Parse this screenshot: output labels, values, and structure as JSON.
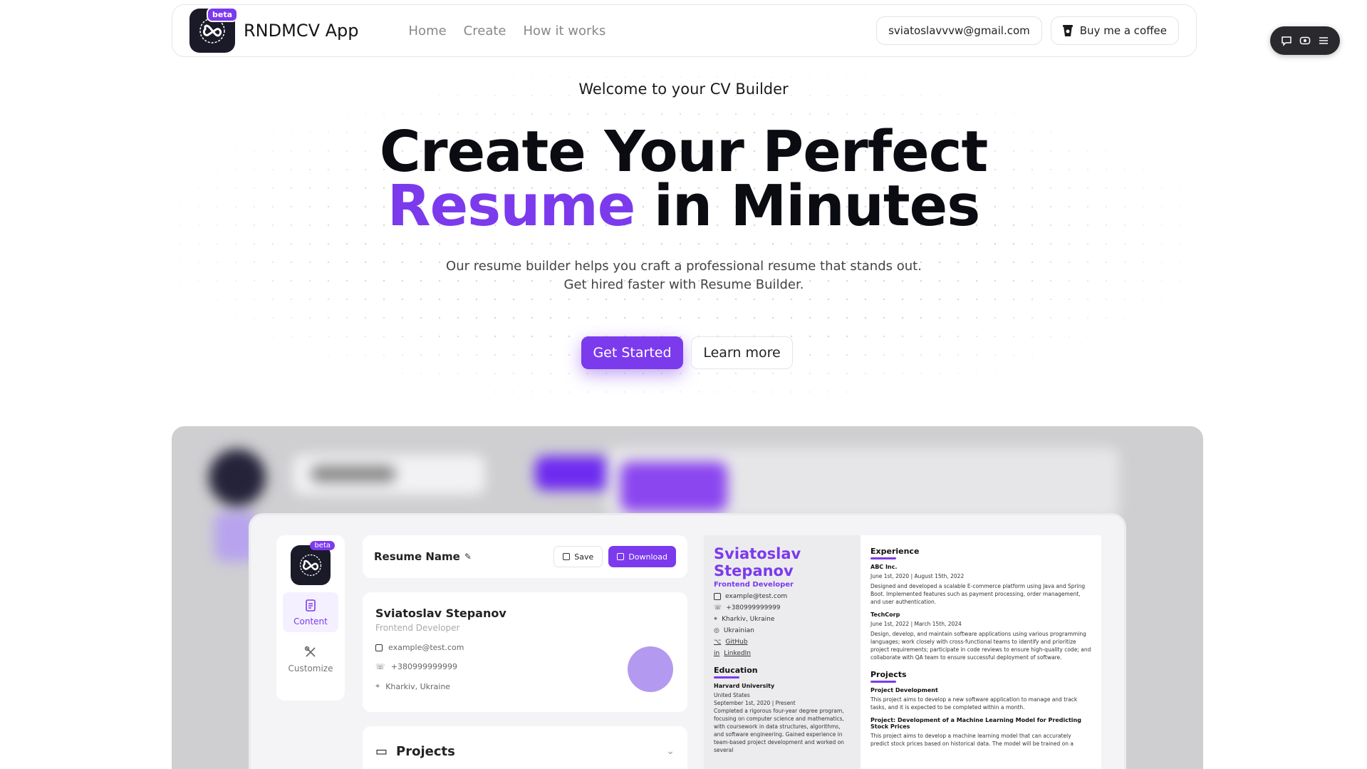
{
  "header": {
    "brand": "RNDMCV App",
    "beta": "beta",
    "nav": [
      "Home",
      "Create",
      "How it works"
    ],
    "email": "sviatoslavvvw@gmail.com",
    "coffee": "Buy me a coffee"
  },
  "hero": {
    "welcome": "Welcome to your CV Builder",
    "title_line1": "Create Your Perfect",
    "title_accent": "Resume",
    "title_rest": " in Minutes",
    "subtitle": "Our resume builder helps you craft a professional resume that stands out. Get hired faster with Resume Builder.",
    "primary_button": "Get Started",
    "secondary_button": "Learn more"
  },
  "preview": {
    "beta": "beta",
    "sidebar": [
      "Content",
      "Customize"
    ],
    "resume_name": "Resume Name",
    "save": "Save",
    "download": "Download",
    "person": {
      "name": "Sviatoslav Stepanov",
      "role": "Frontend Developer",
      "email": "example@test.com",
      "phone": "+380999999999",
      "location": "Kharkiv, Ukraine"
    },
    "projects_label": "Projects",
    "doc": {
      "name": "Sviatoslav Stepanov",
      "role": "Frontend Developer",
      "email": "example@test.com",
      "phone": "+380999999999",
      "location": "Kharkiv, Ukraine",
      "language": "Ukrainian",
      "github": "GitHub",
      "linkedin": "LinkedIn",
      "education_h": "Education",
      "edu_school": "Harvard University",
      "edu_country": "United States",
      "edu_dates": "September 1st, 2020 | Present",
      "edu_text": "Completed a rigorous four-year degree program, focusing on computer science and mathematics, with coursework in data structures, algorithms, and software engineering. Gained experience in team-based project development and worked on several",
      "experience_h": "Experience",
      "exp1_company": "ABC Inc.",
      "exp1_dates": "June 1st, 2020 | August 15th, 2022",
      "exp1_text": "Designed and developed a scalable E-commerce platform using Java and Spring Boot. Implemented features such as payment processing, order management, and user authentication.",
      "exp2_company": "TechCorp",
      "exp2_dates": "June 1st, 2022 | March 15th, 2024",
      "exp2_text": "Design, develop, and maintain software applications using various programming languages; work closely with cross-functional teams to identify and prioritize project requirements; participate in code reviews to ensure high-quality code; and collaborate with QA team to ensure successful deployment of software.",
      "projects_h": "Projects",
      "proj1_title": "Project Development",
      "proj1_text": "This project aims to develop a new software application to manage and track tasks, and it is expected to be completed within a month.",
      "proj2_title": "Project: Development of a Machine Learning Model for Predicting Stock Prices",
      "proj2_text": "This project aims to develop a machine learning model that can accurately predict stock prices based on historical data. The model will be trained on a"
    }
  },
  "colors": {
    "accent": "#7c3aed",
    "dark": "#0b0b12"
  }
}
